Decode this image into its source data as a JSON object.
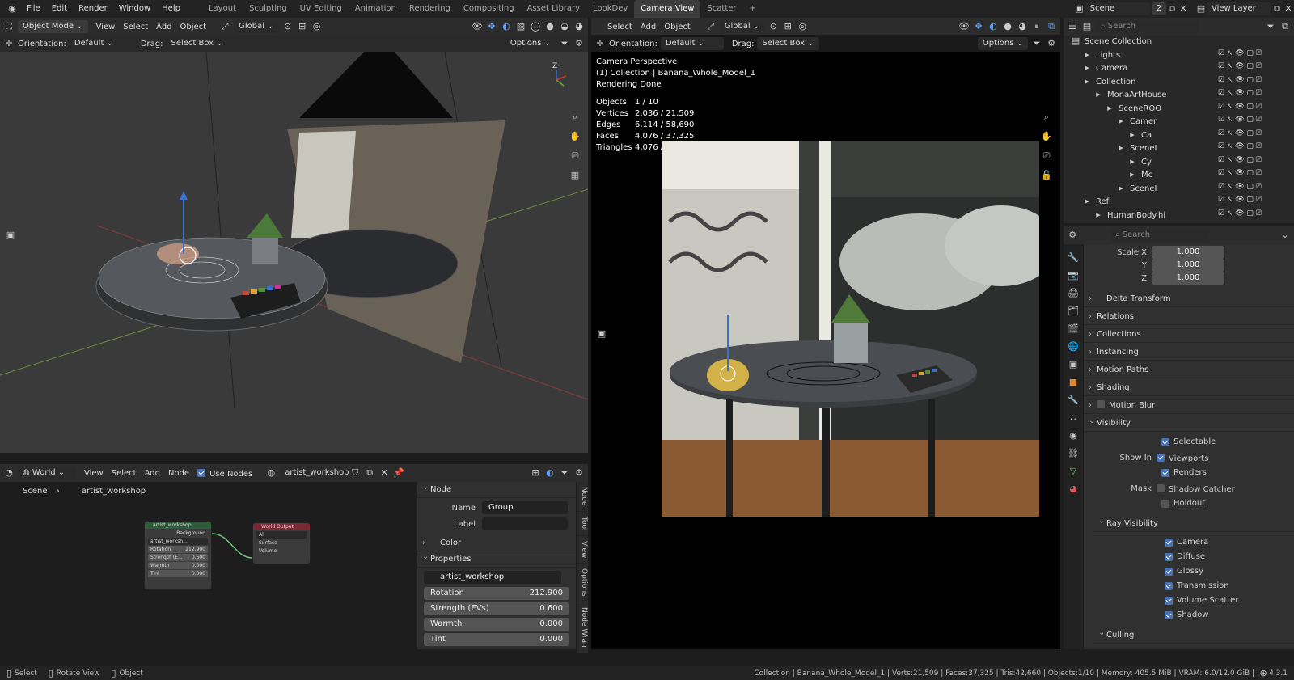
{
  "menubar": {
    "items": [
      "File",
      "Edit",
      "Render",
      "Window",
      "Help"
    ],
    "workspaces": [
      "Layout",
      "Sculpting",
      "UV Editing",
      "Animation",
      "Rendering",
      "Compositing",
      "Asset Library",
      "LookDev",
      "Camera View",
      "Scatter"
    ],
    "active_workspace": "Camera View",
    "add_tab": "+",
    "scene": "Scene",
    "scene_count": "2",
    "view_layer": "View Layer"
  },
  "left_viewport": {
    "mode": "Object Mode",
    "menus": [
      "View",
      "Select",
      "Add",
      "Object"
    ],
    "transform": "Global",
    "orientation_label": "Orientation:",
    "orientation": "Default",
    "drag_label": "Drag:",
    "drag": "Select Box",
    "options": "Options"
  },
  "right_viewport": {
    "menus": [
      "Select",
      "Add",
      "Object"
    ],
    "transform": "Global",
    "orientation_label": "Orientation:",
    "orientation": "Default",
    "drag_label": "Drag:",
    "drag": "Select Box",
    "options": "Options",
    "info": [
      "Camera Perspective",
      "(1) Collection | Banana_Whole_Model_1",
      "Rendering Done"
    ],
    "stats": [
      {
        "k": "Objects",
        "v": "1 / 10"
      },
      {
        "k": "Vertices",
        "v": "2,036 / 21,509"
      },
      {
        "k": "Edges",
        "v": "6,114 / 58,690"
      },
      {
        "k": "Faces",
        "v": "4,076 / 37,325"
      },
      {
        "k": "Triangles",
        "v": "4,076 / 42,660"
      }
    ]
  },
  "node_editor": {
    "world_type": "World",
    "menus": [
      "View",
      "Select",
      "Add",
      "Node"
    ],
    "use_nodes": "Use Nodes",
    "world_name": "artist_workshop",
    "breadcrumb": [
      "Scene",
      "artist_workshop"
    ],
    "node1": {
      "title": "artist_workshop",
      "out": "Background",
      "img": "artist_worksh...",
      "rows": [
        {
          "k": "Rotation",
          "v": "212.900"
        },
        {
          "k": "Strength (E...",
          "v": "0.600"
        },
        {
          "k": "Warmth",
          "v": "0.000"
        },
        {
          "k": "Tint",
          "v": "0.000"
        }
      ]
    },
    "node2": {
      "title": "World Output",
      "target": "All",
      "inputs": [
        "Surface",
        "Volume"
      ]
    }
  },
  "node_sidebar": {
    "node_header": "Node",
    "name_label": "Name",
    "name": "Group",
    "label_label": "Label",
    "label": "",
    "color": "Color",
    "properties": "Properties",
    "group": "artist_workshop",
    "props": [
      {
        "k": "Rotation",
        "v": "212.900"
      },
      {
        "k": "Strength (EVs)",
        "v": "0.600"
      },
      {
        "k": "Warmth",
        "v": "0.000"
      },
      {
        "k": "Tint",
        "v": "0.000"
      }
    ],
    "tabs": [
      "Node",
      "Tool",
      "View",
      "Options",
      "Node Wran"
    ]
  },
  "outliner": {
    "search": "Search",
    "rows": [
      {
        "label": "Scene Collection",
        "indent": 0
      },
      {
        "label": "Lights",
        "indent": 1
      },
      {
        "label": "Camera",
        "indent": 1
      },
      {
        "label": "Collection",
        "indent": 1
      },
      {
        "label": "MonaArtHouse",
        "indent": 2
      },
      {
        "label": "SceneROO",
        "indent": 3
      },
      {
        "label": "Camer",
        "indent": 4
      },
      {
        "label": "Ca",
        "indent": 5
      },
      {
        "label": "SceneI",
        "indent": 4
      },
      {
        "label": "Cy",
        "indent": 5
      },
      {
        "label": "Mc",
        "indent": 5
      },
      {
        "label": "SceneI",
        "indent": 4
      },
      {
        "label": "Ref",
        "indent": 1
      },
      {
        "label": "HumanBody.hi",
        "indent": 2
      }
    ]
  },
  "properties": {
    "search": "Search",
    "scale": [
      {
        "k": "Scale X",
        "v": "1.000"
      },
      {
        "k": "Y",
        "v": "1.000"
      },
      {
        "k": "Z",
        "v": "1.000"
      }
    ],
    "sections": [
      "Delta Transform",
      "Relations",
      "Collections",
      "Instancing",
      "Motion Paths",
      "Shading",
      "Motion Blur"
    ],
    "visibility": "Visibility",
    "selectable": "Selectable",
    "show_in": "Show In",
    "viewports": "Viewports",
    "renders": "Renders",
    "mask": "Mask",
    "shadow_catcher": "Shadow Catcher",
    "holdout": "Holdout",
    "ray_visibility": "Ray Visibility",
    "rays": [
      "Camera",
      "Diffuse",
      "Glossy",
      "Transmission",
      "Volume Scatter",
      "Shadow"
    ],
    "culling": "Culling"
  },
  "statusbar": {
    "left": [
      "Select",
      "Rotate View",
      "Object"
    ],
    "right": "Collection | Banana_Whole_Model_1 | Verts:21,509 | Faces:37,325 | Tris:42,660 | Objects:1/10 | Memory: 405.5 MiB | VRAM: 6.0/12.0 GiB |",
    "version": "4.3.1"
  }
}
